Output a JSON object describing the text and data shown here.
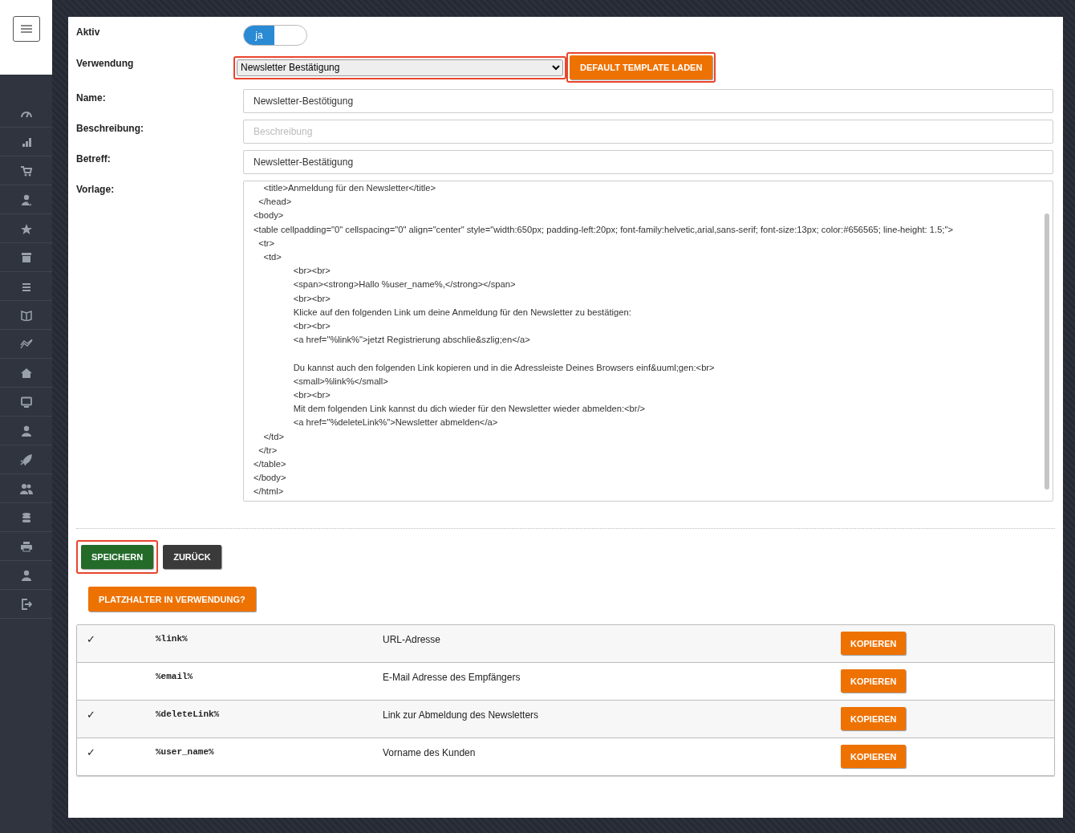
{
  "form": {
    "active": {
      "label": "Aktiv",
      "on": true,
      "value_label": "ja"
    },
    "usage": {
      "label": "Verwendung",
      "value": "Newsletter Bestätigung",
      "highlighted": true
    },
    "load_button": {
      "label": "DEFAULT TEMPLATE LADEN",
      "highlighted": true
    },
    "name": {
      "label": "Name:",
      "value": "Newsletter-Bestötigung"
    },
    "description": {
      "label": "Beschreibung:",
      "placeholder": "Beschreibung"
    },
    "subject": {
      "label": "Betreff:",
      "value": "Newsletter-Bestätigung"
    },
    "template": {
      "label": "Vorlage:",
      "blocks": [
        [
          "    <title>Anmeldung für den Newsletter</title>",
          "  </head>",
          "<body>",
          "<table cellpadding=\"0\" cellspacing=\"0\" align=\"center\" style=\"width:650px; padding-left:20px; font-family:helvetic,arial,sans-serif; font-size:13px; color:#656565; line-height: 1.5;\">",
          "  <tr>",
          "    <td>",
          "                <br><br>",
          "                <span><strong>Hallo %user_name%,</strong></span>",
          "                <br><br>",
          "                Klicke auf den folgenden Link um deine Anmeldung für den Newsletter zu bestätigen:",
          "                <br><br>",
          "                <a href=\"%link%\">jetzt Registrierung abschlie&szlig;en</a>"
        ],
        [
          "                Du kannst auch den folgenden Link kopieren und in die Adressleiste Deines Browsers einf&uuml;gen:<br>",
          "                <small>%link%</small>",
          "                <br><br>",
          "                Mit dem folgenden Link kannst du dich wieder für den Newsletter wieder abmelden:<br/>",
          "                <a href=\"%deleteLink%\">Newsletter abmelden</a>",
          "    </td>",
          "  </tr>",
          "</table>",
          "</body>",
          "</html>"
        ]
      ]
    }
  },
  "actions": [
    {
      "label": "SPEICHERN",
      "kind": "save",
      "highlighted": true
    },
    {
      "label": "ZURÜCK",
      "kind": "back",
      "highlighted": false
    }
  ],
  "placeholder_button": {
    "label": "PLATZHALTER IN VERWENDUNG?"
  },
  "placeholders": [
    {
      "check": "✓",
      "code": "%link%",
      "description": "URL-Adresse",
      "button": "KOPIEREN"
    },
    {
      "code": "%email%",
      "description": "E-Mail Adresse des Empfängers",
      "button": "KOPIEREN"
    },
    {
      "check": "✓",
      "code": "%deleteLink%",
      "description": "Link zur Abmeldung des Newsletters",
      "button": "KOPIEREN"
    },
    {
      "check": "✓",
      "code": "%user_name%",
      "description": "Vorname des Kunden",
      "button": "KOPIEREN"
    }
  ]
}
